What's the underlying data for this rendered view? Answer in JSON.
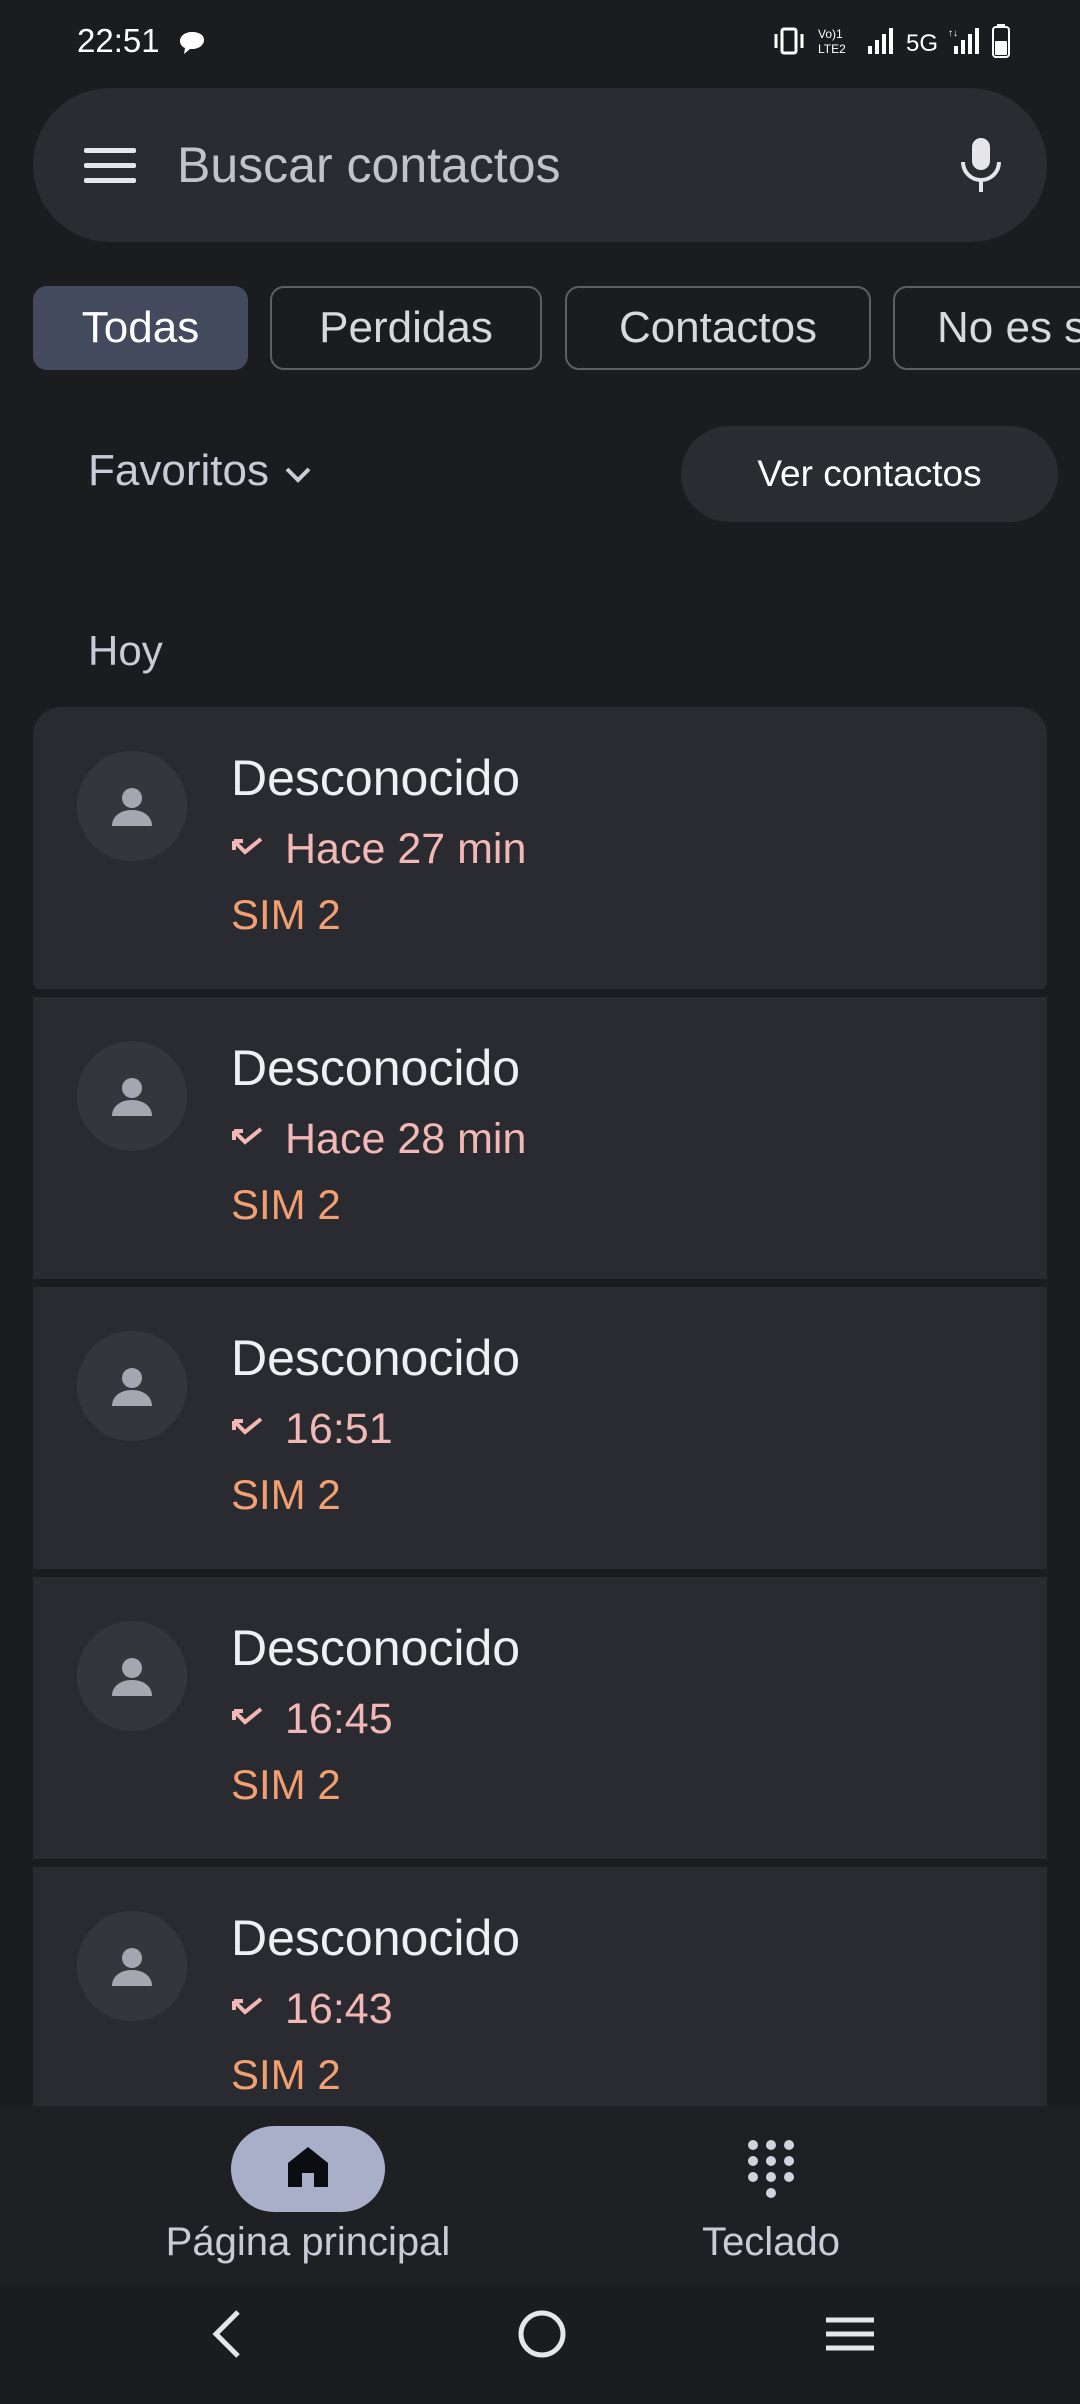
{
  "status_bar": {
    "time": "22:51",
    "indicators": [
      "vibrate-icon",
      "volte-lte2-icon",
      "signal-icon",
      "5g-label",
      "signal-icon",
      "battery-icon"
    ],
    "network_label": "5G",
    "volte_label": "VoLTE"
  },
  "search": {
    "placeholder": "Buscar contactos"
  },
  "filters": [
    {
      "label": "Todas",
      "active": true
    },
    {
      "label": "Perdidas",
      "active": false
    },
    {
      "label": "Contactos",
      "active": false
    },
    {
      "label": "No es s",
      "active": false
    }
  ],
  "favorites": {
    "label": "Favoritos",
    "view_contacts": "Ver contactos"
  },
  "section_label": "Hoy",
  "calls": [
    {
      "name": "Desconocido",
      "time": "Hace 27 min",
      "sim": "SIM 2"
    },
    {
      "name": "Desconocido",
      "time": "Hace 28 min",
      "sim": "SIM 2"
    },
    {
      "name": "Desconocido",
      "time": "16:51",
      "sim": "SIM 2"
    },
    {
      "name": "Desconocido",
      "time": "16:45",
      "sim": "SIM 2"
    },
    {
      "name": "Desconocido",
      "time": "16:43",
      "sim": "SIM 2"
    }
  ],
  "bottom_nav": {
    "home": "Página principal",
    "keypad": "Teclado"
  },
  "colors": {
    "background": "#1b1c20",
    "card": "#2a2b30",
    "missed_call": "#f2b8b5",
    "sim_label": "#f3a070",
    "active_chip": "#434a5e"
  }
}
